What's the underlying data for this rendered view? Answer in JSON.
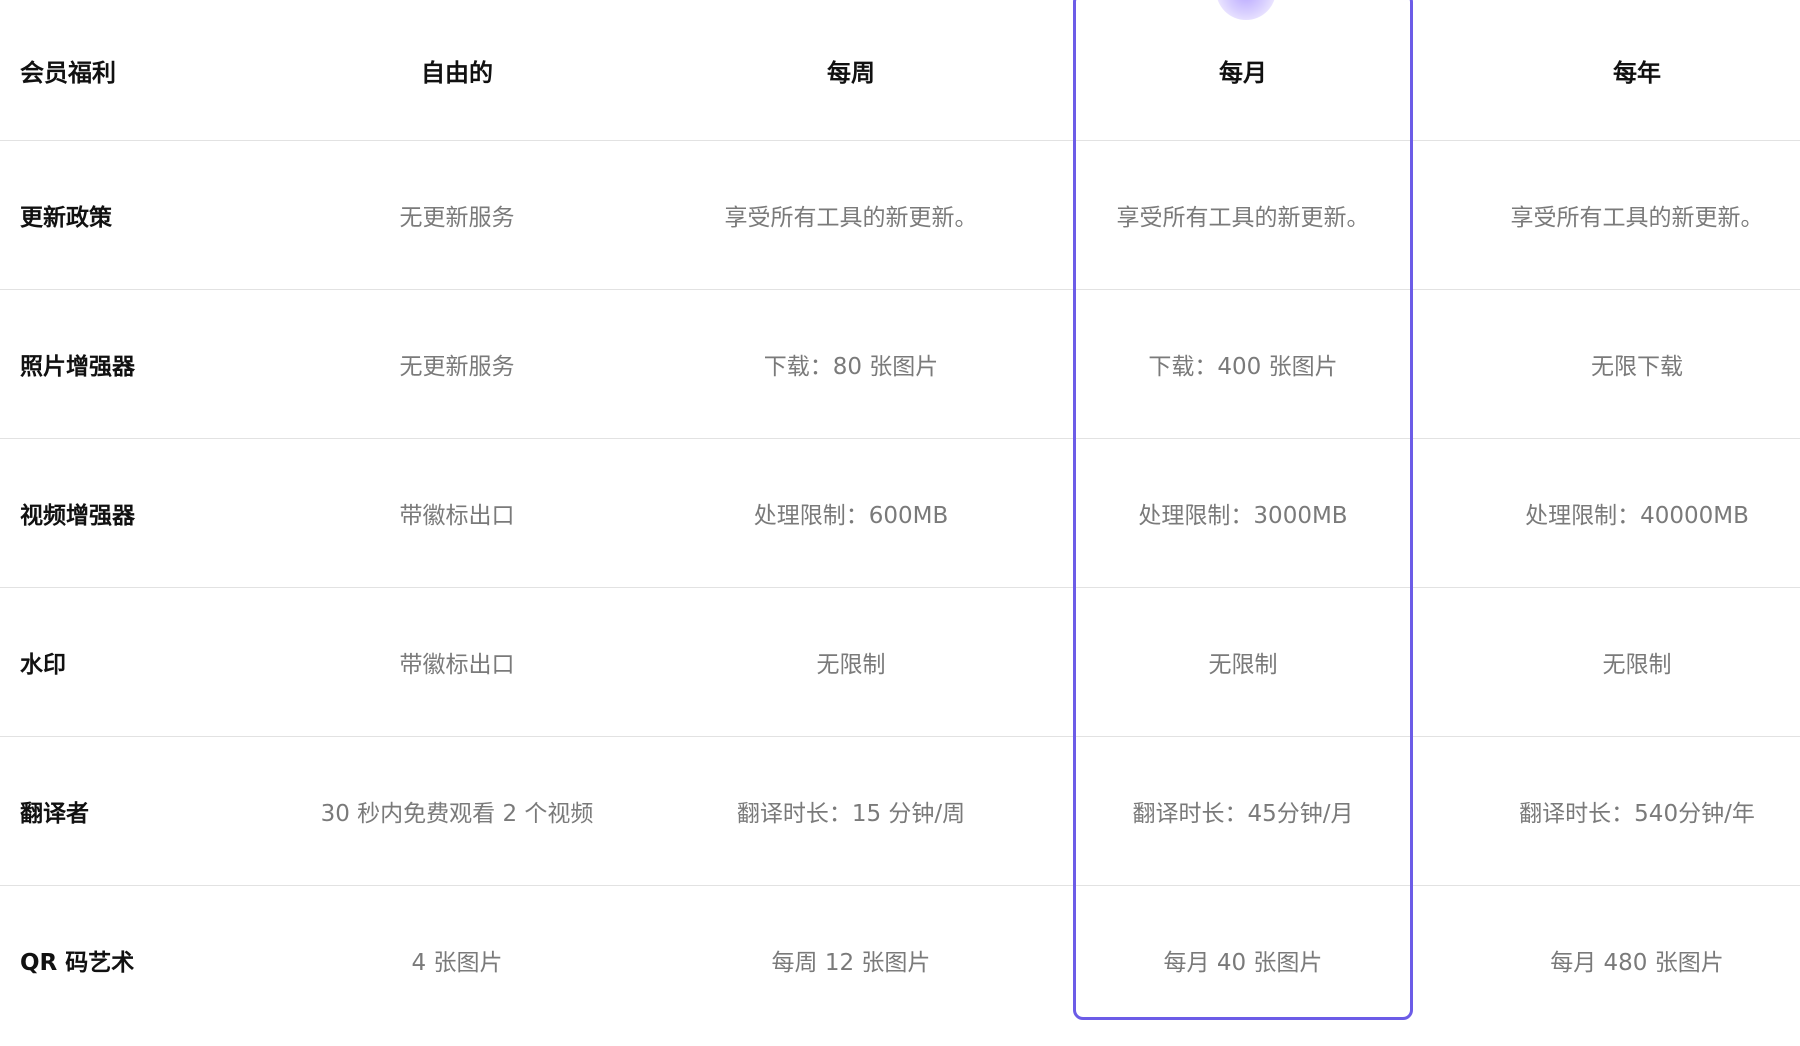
{
  "accent_color": "#6c5ce7",
  "header": {
    "label": "会员福利",
    "plans": [
      "自由的",
      "每周",
      "每月",
      "每年"
    ]
  },
  "highlighted_plan": "每月",
  "rows": [
    {
      "label": "更新政策",
      "values": [
        "无更新服务",
        "享受所有工具的新更新。",
        "享受所有工具的新更新。",
        "享受所有工具的新更新。"
      ]
    },
    {
      "label": "照片增强器",
      "values": [
        "无更新服务",
        "下载：80 张图片",
        "下载：400 张图片",
        "无限下载"
      ]
    },
    {
      "label": "视频增强器",
      "values": [
        "带徽标出口",
        "处理限制：600MB",
        "处理限制：3000MB",
        "处理限制：40000MB"
      ]
    },
    {
      "label": "水印",
      "values": [
        "带徽标出口",
        "无限制",
        "无限制",
        "无限制"
      ]
    },
    {
      "label": "翻译者",
      "values": [
        "30 秒内免费观看 2 个视频",
        "翻译时长：15 分钟/周",
        "翻译时长：45分钟/月",
        "翻译时长：540分钟/年"
      ]
    },
    {
      "label": "QR 码艺术",
      "values": [
        "4 张图片",
        "每周 12 张图片",
        "每月 40 张图片",
        "每月 480 张图片"
      ]
    }
  ]
}
